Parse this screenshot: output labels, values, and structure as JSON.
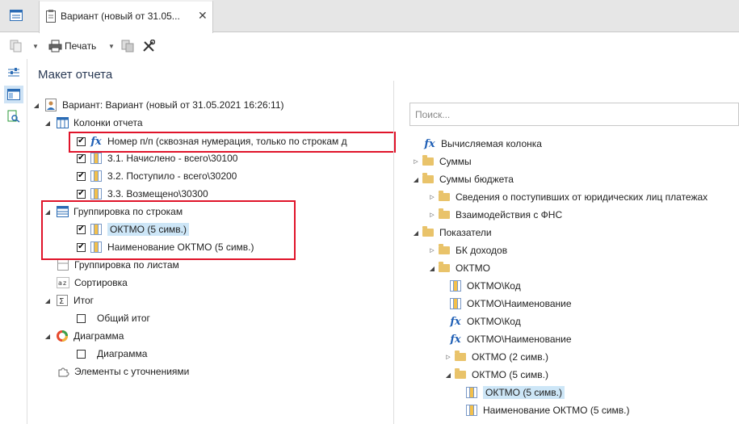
{
  "tabs": {
    "home_icon": "grid-icon",
    "active_tab_title": "Вариант (новый от 31.05...",
    "close_glyph": "✕"
  },
  "toolbar": {
    "print_label": "Печать"
  },
  "panel": {
    "title": "Макет отчета"
  },
  "report_tree": {
    "root": "Вариант: Вариант (новый от 31.05.2021 16:26:11)",
    "columns_group": "Колонки отчета",
    "columns": [
      {
        "label": "Номер п/п (сквозная нумерация, только по строкам д",
        "checked": true,
        "icon": "fx-icon"
      },
      {
        "label": "3.1. Начислено - всего\\30100",
        "checked": true,
        "icon": "table-icon"
      },
      {
        "label": "3.2. Поступило - всего\\30200",
        "checked": true,
        "icon": "table-icon"
      },
      {
        "label": "3.3. Возмещено\\30300",
        "checked": true,
        "icon": "table-icon"
      }
    ],
    "row_grouping": "Группировка по строкам",
    "row_group_items": [
      {
        "label": "ОКТМО (5 симв.)",
        "checked": true,
        "selected": true
      },
      {
        "label": "Наименование ОКТМО (5 симв.)",
        "checked": true,
        "selected": false
      }
    ],
    "sheet_grouping": "Группировка по листам",
    "sorting": "Сортировка",
    "total": "Итог",
    "total_item": "Общий итог",
    "chart": "Диаграмма",
    "chart_item": "Диаграмма",
    "refinements": "Элементы с уточнениями"
  },
  "search": {
    "placeholder": "Поиск..."
  },
  "field_tree": {
    "computed": "Вычисляемая колонка",
    "sums": "Суммы",
    "budget_sums": "Суммы бюджета",
    "budget_child_1": "Сведения о поступивших от юридических лиц платежах",
    "budget_child_2": "Взаимодействия с ФНС",
    "indicators": "Показатели",
    "bk_income": "БК доходов",
    "oktmo": "ОКТМО",
    "oktmo_code": "ОКТМО\\Код",
    "oktmo_name": "ОКТМО\\Наименование",
    "oktmo_code_fx": "ОКТМО\\Код",
    "oktmo_name_fx": "ОКТМО\\Наименование",
    "oktmo_2": "ОКТМО (2 симв.)",
    "oktmo_5": "ОКТМО (5 симв.)",
    "oktmo_5_item": "ОКТМО (5 симв.)",
    "oktmo_5_name": "Наименование ОКТМО (5 симв.)"
  },
  "colors": {
    "highlight_box": "#e0142a",
    "selection": "#cde6f7",
    "title": "#2a3a55"
  }
}
